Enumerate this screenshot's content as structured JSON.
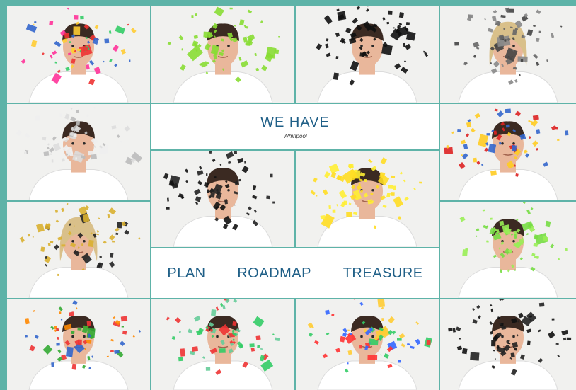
{
  "banner": {
    "headline": "WE HAVE",
    "brand": "Whirlpool",
    "words": [
      "PLAN",
      "ROADMAP",
      "TREASURE"
    ]
  },
  "colors": {
    "frame": "#5eb3a8",
    "text": "#1f5f87",
    "banner_bg": "#ffffff",
    "shirt": "#ffffff",
    "skin": "#e9b79b",
    "hair_dark": "#3b2a22",
    "hair_blonde": "#d9c08a"
  },
  "tiles": [
    {
      "id": "p1",
      "hair": "hair_dark",
      "confetti": [
        "#e33",
        "#36c",
        "#fc3",
        "#3c6",
        "#f39"
      ]
    },
    {
      "id": "p2",
      "hair": "hair_dark",
      "confetti": [
        "#8d3",
        "#8d3",
        "#8d3"
      ]
    },
    {
      "id": "p3",
      "hair": "hair_dark",
      "confetti": [
        "#111",
        "#111",
        "#111"
      ]
    },
    {
      "id": "p4",
      "hair": "hair_blonde",
      "confetti": [
        "#666",
        "#444",
        "#888"
      ]
    },
    {
      "id": "p5",
      "hair": "hair_dark",
      "confetti": [
        "#ddd",
        "#bbb",
        "#eee"
      ]
    },
    {
      "id": "p6",
      "hair": "hair_dark",
      "confetti": [
        "#d22",
        "#fc2",
        "#36c"
      ]
    },
    {
      "id": "p7",
      "hair": "hair_dark",
      "confetti": [
        "#111",
        "#222"
      ]
    },
    {
      "id": "p8",
      "hair": "hair_dark",
      "confetti": [
        "#fd2",
        "#fe3"
      ]
    },
    {
      "id": "p9",
      "hair": "hair_blonde",
      "confetti": [
        "#d9b030",
        "#222",
        "#d9b030"
      ]
    },
    {
      "id": "p10",
      "hair": "hair_dark",
      "confetti": [
        "#7d4",
        "#9e5"
      ]
    },
    {
      "id": "p11",
      "hair": "hair_dark",
      "confetti": [
        "#f80",
        "#e33",
        "#3a3",
        "#36c"
      ]
    },
    {
      "id": "p12",
      "hair": "hair_dark",
      "confetti": [
        "#e33",
        "#6c9",
        "#3c6"
      ]
    },
    {
      "id": "p13",
      "hair": "hair_dark",
      "confetti": [
        "#f33",
        "#36f",
        "#fc3",
        "#3c6"
      ]
    },
    {
      "id": "p14",
      "hair": "hair_dark",
      "confetti": [
        "#111",
        "#222"
      ]
    }
  ]
}
